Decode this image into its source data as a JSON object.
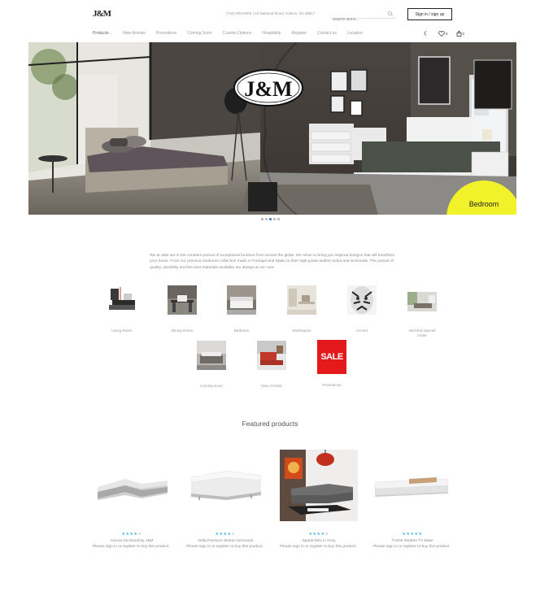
{
  "header": {
    "logo_text": "J&M",
    "contact": "(732) 000-0000 | 44 National Road, Edison, NJ 08817",
    "search_placeholder": "Search items...",
    "signin_label": "Sign in / sign up"
  },
  "nav": {
    "items": [
      "Products",
      "New Arrivals",
      "Promotions",
      "Coming Soon",
      "Custom Options",
      "Hospitality",
      "Register",
      "Contact us",
      "Location"
    ],
    "wishlist_count": "0",
    "cart_count": "0"
  },
  "hero": {
    "logo_text": "J&M",
    "badge_label": "Bedroom",
    "slides": 5,
    "active_slide": 3
  },
  "intro": {
    "text": "We at J&M are in the constant pursuit of exceptional furniture from across the globe. We strive to bring you inspired designs that will transform your home. From our premium bedroom collection made in Portugal and Spain to their high-grade leather sofas and sectionals. The pursuit of quality, durability and the best materials available are always at our core."
  },
  "categories": [
    {
      "label": "Living Room"
    },
    {
      "label": "Dining Room"
    },
    {
      "label": "Bedroom"
    },
    {
      "label": "Workspace"
    },
    {
      "label": "Accent"
    },
    {
      "label": "Ital-Mod Special Order"
    },
    {
      "label": "Coming Soon"
    },
    {
      "label": "New Arrivals"
    },
    {
      "label": "Promotions",
      "image_text": "SALE"
    }
  ],
  "featured": {
    "title": "Featured products",
    "note": "Please sign in or register to buy this product.",
    "products": [
      {
        "name": "Aurora Sectional by J&M",
        "rating": 4
      },
      {
        "name": "Vella Premium Motion Sectional",
        "rating": 4
      },
      {
        "name": "Sparta Mini in Grey",
        "rating": 4
      },
      {
        "name": "TV045 Modern TV Base",
        "rating": 5
      }
    ]
  },
  "colors": {
    "accent_yellow": "#f2f22a",
    "star_blue": "#3fb5dc",
    "sale_red": "#e3191b"
  }
}
